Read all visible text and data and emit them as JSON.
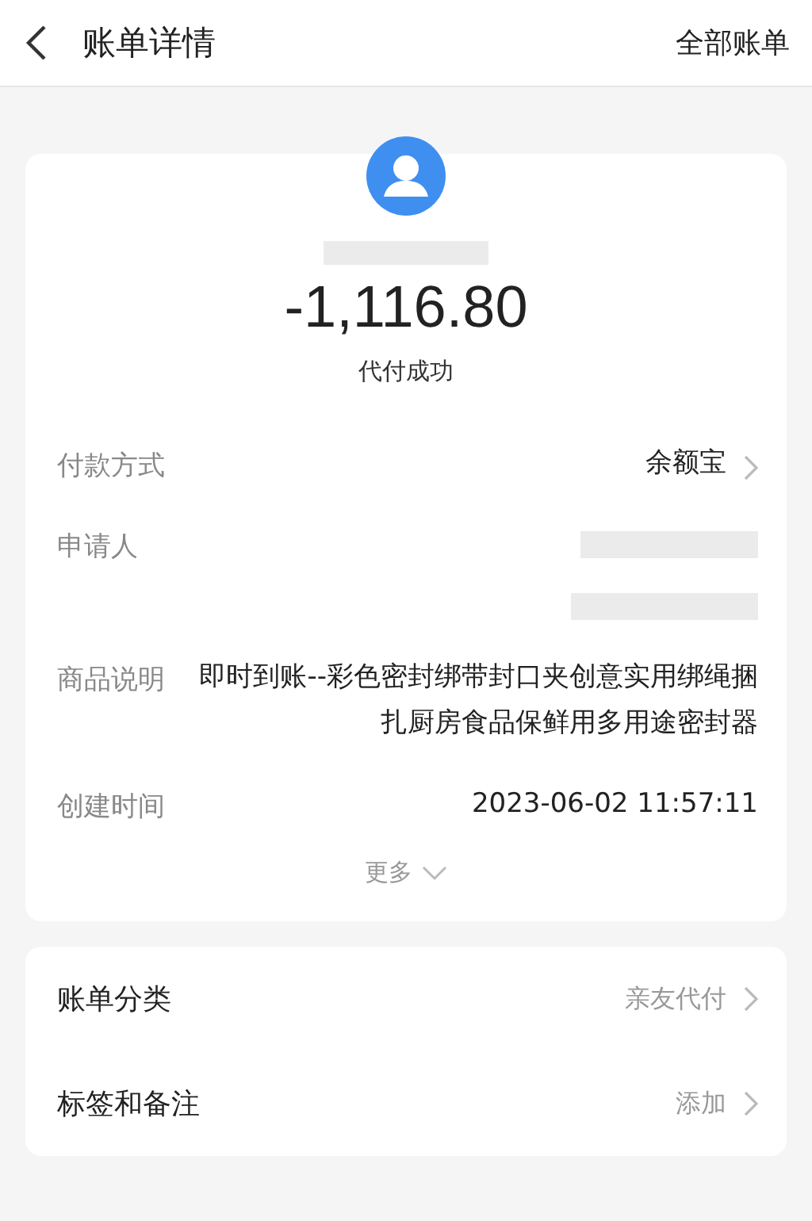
{
  "header": {
    "title": "账单详情",
    "action": "全部账单"
  },
  "summary": {
    "amount": "-1,116.80",
    "status": "代付成功"
  },
  "details": [
    {
      "kind": "link",
      "label": "付款方式",
      "value": "余额宝"
    },
    {
      "kind": "redacted",
      "label": "申请人"
    },
    {
      "kind": "text",
      "label": "商品说明",
      "value": "即时到账--彩色密封绑带封口夹创意实用绑绳捆扎厨房食品保鲜用多用途密封器"
    },
    {
      "kind": "text",
      "label": "创建时间",
      "value": "2023-06-02 11:57:11"
    }
  ],
  "more": "更多",
  "settings": [
    {
      "label": "账单分类",
      "value": "亲友代付"
    },
    {
      "label": "标签和备注",
      "value": "添加"
    }
  ]
}
